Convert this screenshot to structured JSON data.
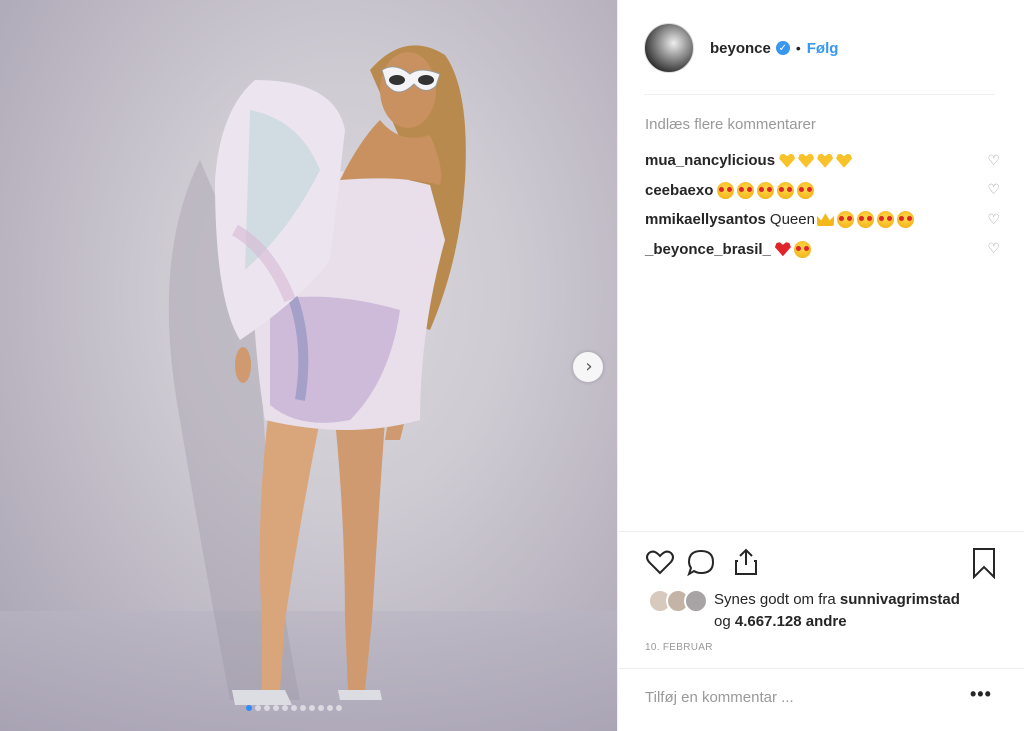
{
  "post": {
    "username": "beyonce",
    "separator": "•",
    "follow_label": "Følg",
    "photo_count": 11,
    "active_photo": 1
  },
  "comments": {
    "load_more_label": "Indlæs flere kommentarer",
    "items": [
      {
        "user": "mua_nancylicious",
        "text": "",
        "emojis": [
          "yellow-heart",
          "yellow-heart",
          "yellow-heart",
          "yellow-heart"
        ]
      },
      {
        "user": "ceebaexo",
        "text": "",
        "emojis": [
          "heart-eyes",
          "heart-eyes",
          "heart-eyes",
          "heart-eyes",
          "heart-eyes"
        ]
      },
      {
        "user": "mmikaellysantos",
        "text": "Queen",
        "emojis": [
          "crown",
          "heart-eyes",
          "heart-eyes",
          "heart-eyes",
          "heart-eyes"
        ]
      },
      {
        "user": "_beyonce_brasil_",
        "text": "",
        "emojis": [
          "red-heart",
          "heart-eyes"
        ]
      }
    ]
  },
  "likes": {
    "prefix": "Synes godt om fra",
    "liked_by": "sunnivagrimstad",
    "and": "og",
    "count": "4.667.128",
    "suffix": "andre"
  },
  "date": "10. FEBRUAR",
  "comment_placeholder": "Tilføj en kommentar ...",
  "more_label": "•••",
  "colors": {
    "accent": "#3897f0",
    "text": "#262626",
    "muted": "#999999",
    "divider": "#efefef"
  }
}
